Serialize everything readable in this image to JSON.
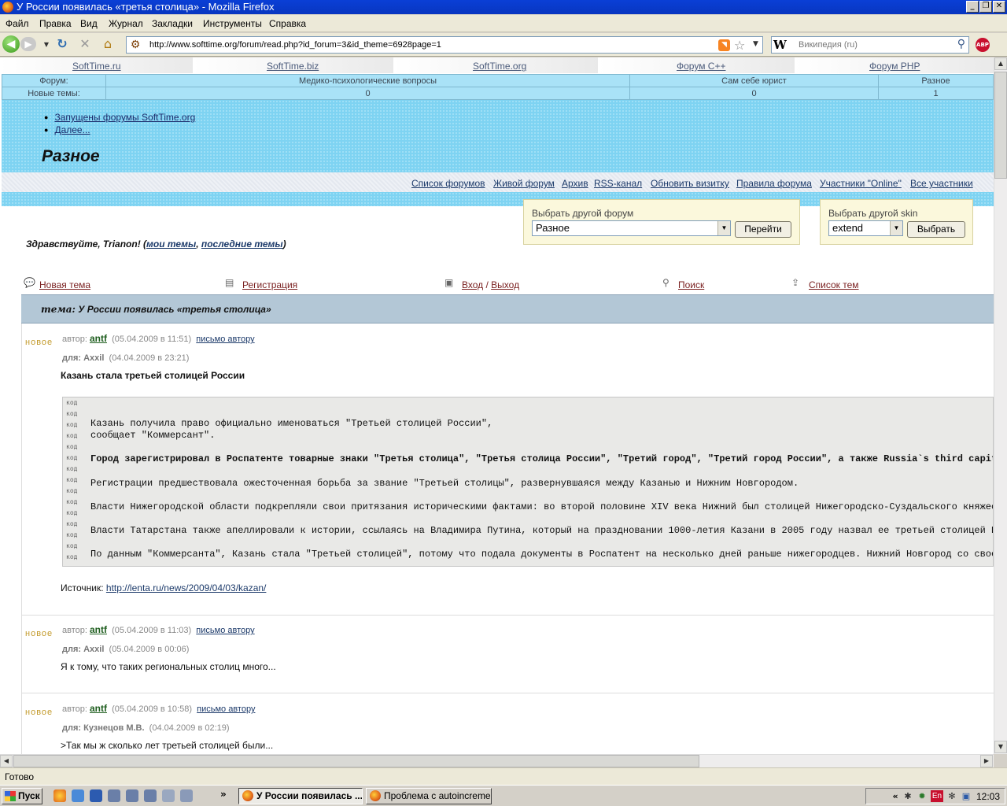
{
  "window": {
    "title": "У России появилась «третья столица» - Mozilla Firefox",
    "minimize_glyph": "_",
    "maximize_glyph": "❐",
    "close_glyph": "✕"
  },
  "menubar": {
    "items": [
      "Файл",
      "Правка",
      "Вид",
      "Журнал",
      "Закладки",
      "Инструменты",
      "Справка"
    ]
  },
  "navbar": {
    "url": "http://www.softtime.org/forum/read.php?id_forum=3&id_theme=6928page=1",
    "search_engine": "W",
    "search_placeholder": "Википедия (ru)",
    "icons": [
      "back-icon",
      "forward-icon",
      "reload-icon",
      "stop-icon",
      "home-icon",
      "rss-icon",
      "star-icon",
      "search-icon",
      "adblock-icon"
    ]
  },
  "page": {
    "top_links": [
      "SoftTime.ru",
      "SoftTime.biz",
      "SoftTime.org",
      "Форум C++",
      "Форум PHP"
    ],
    "forum_table": {
      "row1_label": "Форум:",
      "row2_label": "Новые темы:",
      "forums": [
        {
          "name": "Медико-психологические вопросы",
          "new": "0"
        },
        {
          "name": "Сам себе юрист",
          "new": "0"
        },
        {
          "name": "Разное",
          "new": "1"
        }
      ]
    },
    "banner_links": [
      "Запущены форумы SoftTime.org",
      "Далее..."
    ],
    "page_title": "Разное"
  },
  "forum_nav": {
    "links": [
      "Список форумов",
      "Живой форум",
      "Архив",
      "RSS-канал",
      "Обновить визитку",
      "Правила форума",
      "Участники \"Online\"",
      "Все участники"
    ]
  },
  "selectors": {
    "forum_label": "Выбрать другой форум",
    "forum_value": "Разное",
    "forum_button": "Перейти",
    "skin_label": "Выбрать другой skin",
    "skin_value": "extend",
    "skin_button": "Выбрать"
  },
  "welcome": {
    "greeting": "Здравствуйте, Trianon! (",
    "my_topics": "мои темы",
    "comma": ", ",
    "last_topics": "последние темы",
    "close": ")"
  },
  "actions": {
    "new_topic": "Новая тема",
    "register": "Регистрация",
    "login": "Вход",
    "slash": " / ",
    "logout": "Выход",
    "search": "Поиск",
    "topics_list": "Список тем"
  },
  "topic": {
    "label": "тема:",
    "title": "У России появилась «третья столица»"
  },
  "posts": [
    {
      "new_label": "новое",
      "author_label": "автор:",
      "author": "antf",
      "date": "(05.04.2009 в 11:51)",
      "mail": "письмо автору",
      "for_label": "для: Axxil",
      "for_date": "(04.04.2009 в 23:21)",
      "text": "Казань стала третьей столицей России",
      "code_gutter": "код",
      "code_lines": [
        "Казань получила право официально именоваться \"Третьей столицей России\",",
        "сообщает \"Коммерсант\".",
        "Город зарегистрировал в Роспатенте товарные знаки \"Третья столица\", \"Третья столица России\", \"Третий город\", \"Третий город России\", а также Russia`s third capital.",
        "Регистрации предшествовала ожесточенная борьба за звание \"Третьей столицы\", развернувшаяся между Казанью и Нижним Новгородом.",
        "Власти Нижегородской области подкрепляли свои притязания историческими фактами: во второй половине XIV века Нижний был столицей Нижегородско-Суздальского княжества.",
        "Власти Татарстана также апеллировали к истории, ссылаясь на Владимира Путина, который на праздновании 1000-летия Казани в 2005 году назвал ее третьей столицей России.",
        "По данным \"Коммерсанта\", Казань стала \"Третьей столицей\", потому что подала документы в Роспатент на несколько дней раньше нижегородцев. Нижний Новгород со своей стороны"
      ],
      "source_label": "Источник: ",
      "source_url": "http://lenta.ru/news/2009/04/03/kazan/"
    },
    {
      "new_label": "новое",
      "author_label": "автор:",
      "author": "antf",
      "date": "(05.04.2009 в 11:03)",
      "mail": "письмо автору",
      "for_label": "для: Axxil",
      "for_date": "(05.04.2009 в 00:06)",
      "text": "Я к тому, что таких региональных столиц много..."
    },
    {
      "new_label": "новое",
      "author_label": "автор:",
      "author": "antf",
      "date": "(05.04.2009 в 10:58)",
      "mail": "письмо автору",
      "for_label": "для: Кузнецов М.В.",
      "for_date": "(04.04.2009 в 02:19)",
      "text": ">Так мы ж сколько лет третьей столицей были..."
    }
  ],
  "statusbar": {
    "text": "Готово"
  },
  "taskbar": {
    "start": "Пуск",
    "overflow": "»",
    "tasks": [
      {
        "label": "У России появилась ...",
        "active": true
      },
      {
        "label": "Проблема с autoincreme...",
        "active": false
      }
    ],
    "tray_chevron": "«",
    "lang": "En",
    "clock": "12:03"
  }
}
